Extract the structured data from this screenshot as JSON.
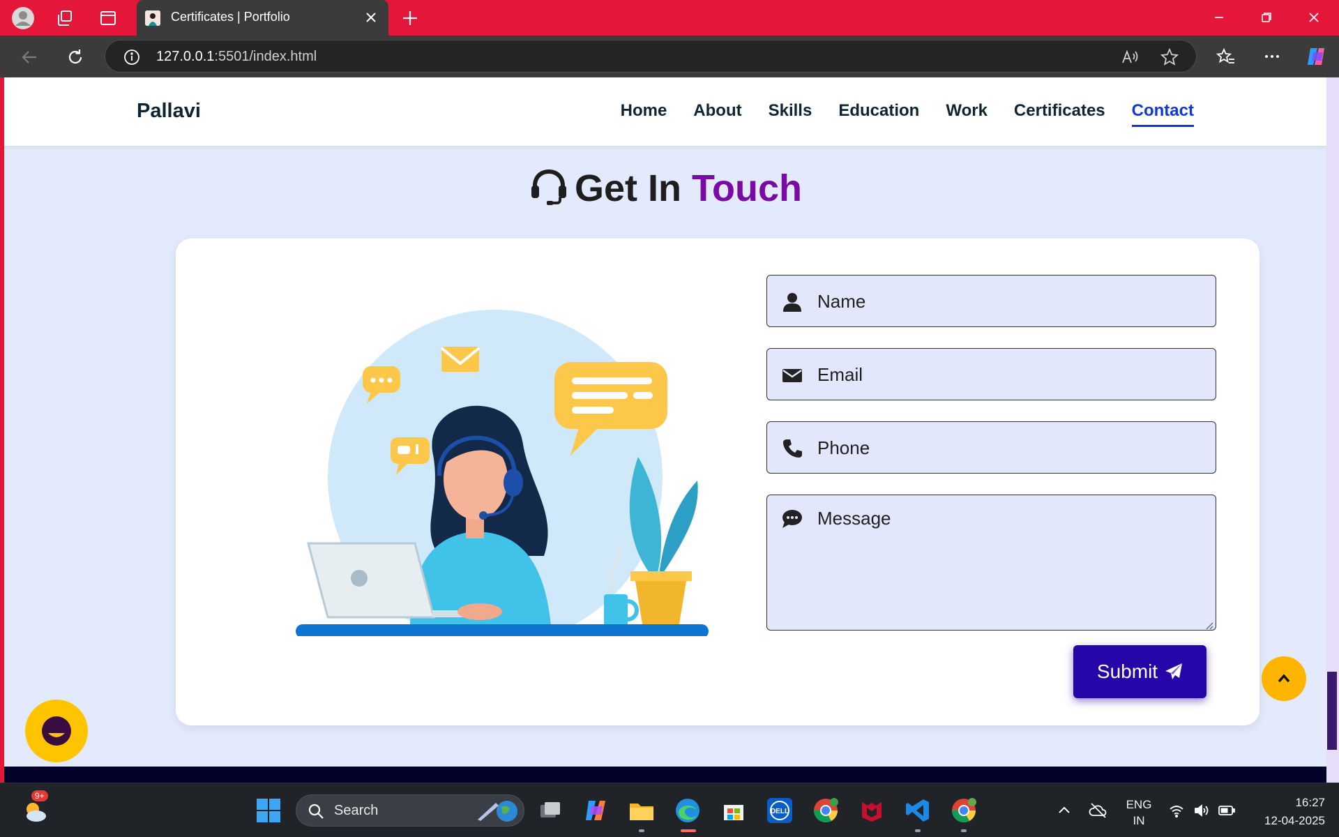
{
  "browser": {
    "tab_title": "Certificates | Portfolio",
    "url_host": "127.0.0.1",
    "url_rest": ":5501/index.html"
  },
  "site": {
    "brand": "Pallavi",
    "nav": [
      "Home",
      "About",
      "Skills",
      "Education",
      "Work",
      "Certificates",
      "Contact"
    ],
    "active_nav": "Contact"
  },
  "contact": {
    "title_plain": "Get In",
    "title_highlight": "Touch",
    "fields": {
      "name_placeholder": "Name",
      "email_placeholder": "Email",
      "phone_placeholder": "Phone",
      "message_placeholder": "Message"
    },
    "submit_label": "Submit"
  },
  "taskbar": {
    "weather_badge": "9+",
    "search_placeholder": "Search",
    "lang_top": "ENG",
    "lang_bottom": "IN",
    "time": "16:27",
    "date": "12-04-2025"
  },
  "colors": {
    "browser_frame": "#e4173a",
    "page_bg": "#e3eafb",
    "nav_active": "#0e39d8",
    "title_highlight": "#7a0aa6",
    "submit_bg": "#2606a8",
    "totop_bg": "#ffb400",
    "chatbot_bg": "#ffc400"
  }
}
